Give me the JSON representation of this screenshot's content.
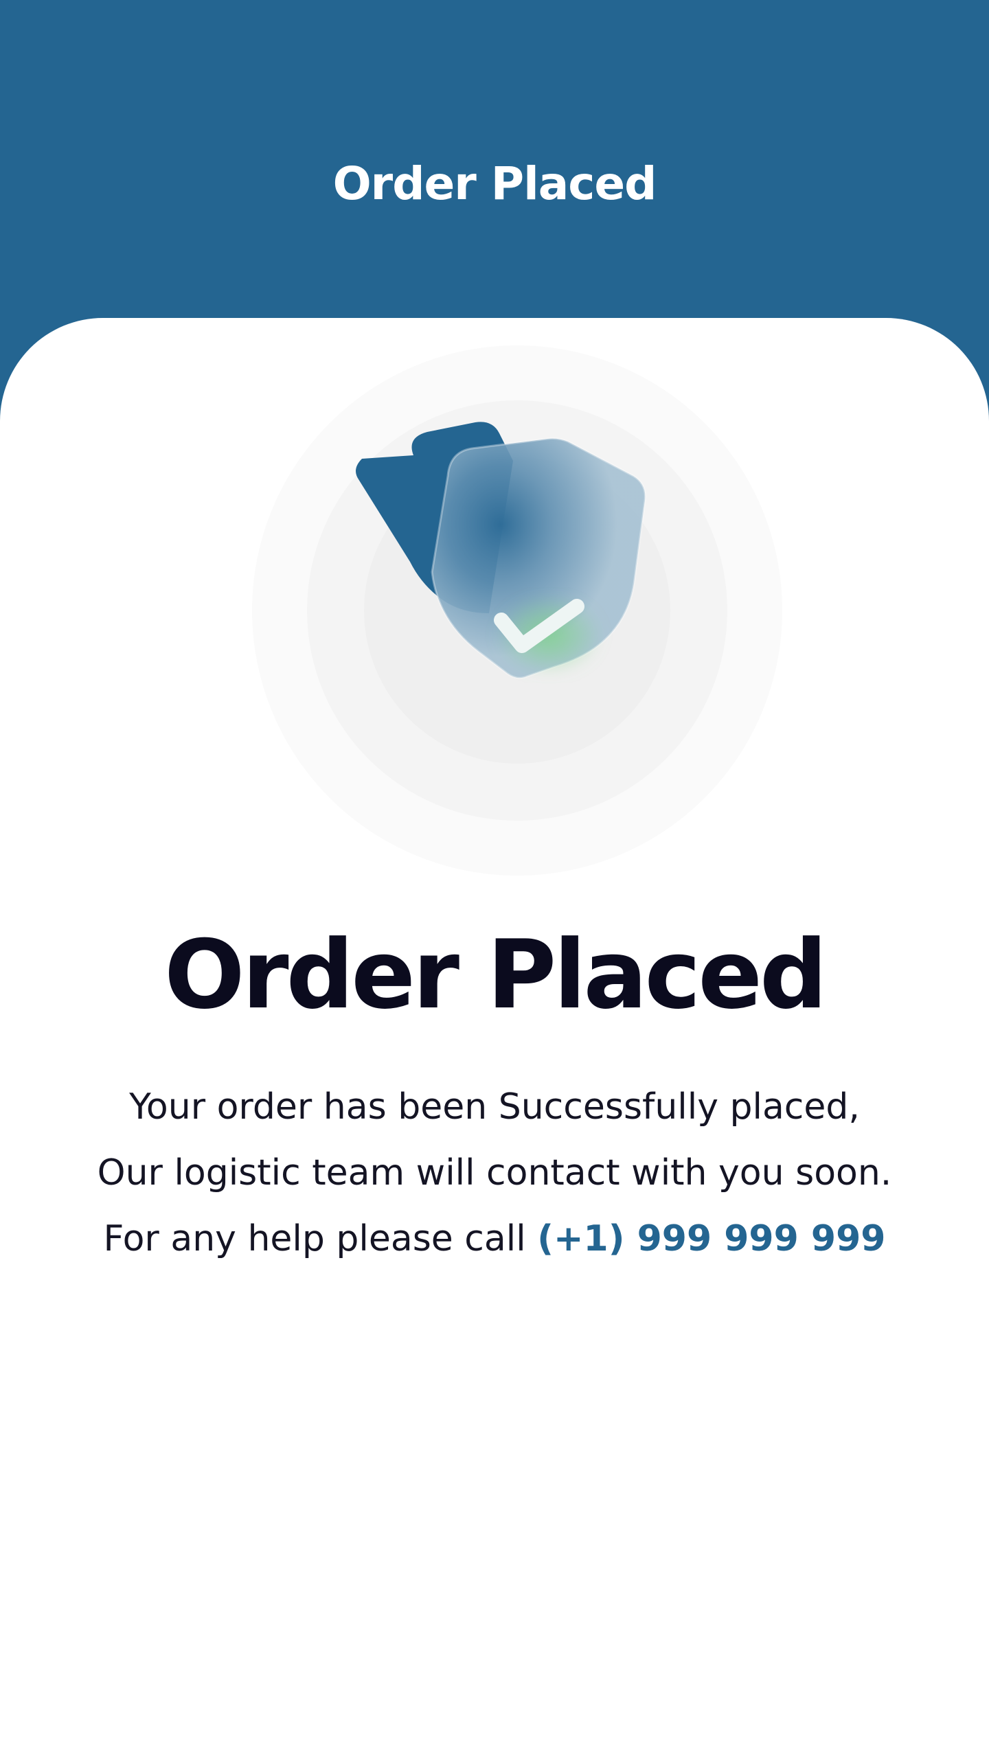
{
  "header": {
    "title": "Order Placed"
  },
  "illustration": {
    "icon": "shield-check-icon"
  },
  "content": {
    "title": "Order Placed",
    "line1": "Your order has been Successfully placed,",
    "line2": "Our logistic team will contact with you soon.",
    "line3_prefix": "For any help please call",
    "phone": "(+1) 999 999 999"
  },
  "colors": {
    "primary": "#246591",
    "title_text": "#0b0b1e",
    "body_text": "#141424",
    "background": "#ffffff",
    "success_glow": "#7fd38a"
  }
}
